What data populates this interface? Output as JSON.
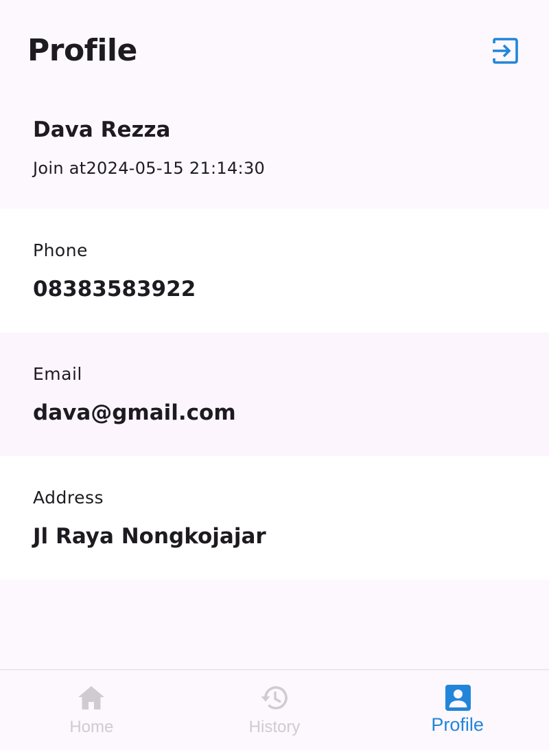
{
  "app_bar": {
    "title": "Profile",
    "logout_icon": "logout-icon"
  },
  "profile": {
    "name": "Dava Rezza",
    "joined": "Join at2024-05-15 21:14:30"
  },
  "fields": {
    "phone": {
      "label": "Phone",
      "value": "08383583922"
    },
    "email": {
      "label": "Email",
      "value": "dava@gmail.com"
    },
    "address": {
      "label": "Address",
      "value": "Jl Raya Nongkojajar"
    }
  },
  "nav": {
    "home": {
      "label": "Home",
      "icon": "home-icon"
    },
    "history": {
      "label": "History",
      "icon": "history-icon"
    },
    "profile": {
      "label": "Profile",
      "icon": "account-box-icon"
    }
  },
  "colors": {
    "accent": "#2186d9",
    "inactive_nav": "#cfcbd1",
    "background": "#fdf7fe",
    "text": "#1d1b20"
  }
}
